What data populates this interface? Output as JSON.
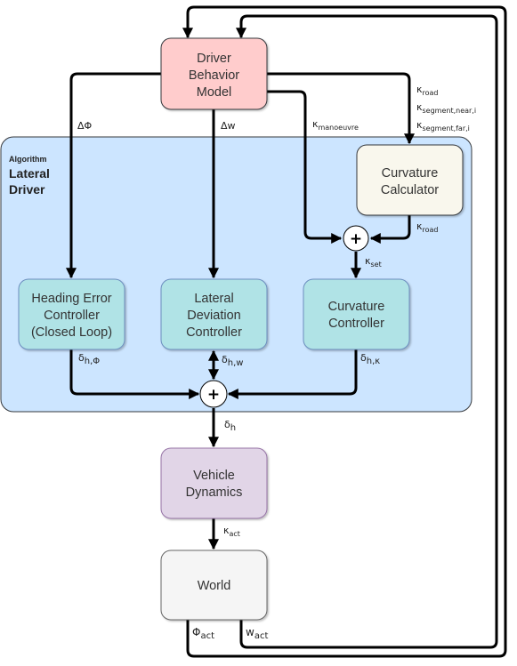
{
  "group": {
    "caption": "Algorithm",
    "title_lines": [
      "Lateral",
      "Driver"
    ],
    "fill": "#cce5ff"
  },
  "blocks": {
    "driver_behavior_model": {
      "lines": [
        "Driver",
        "Behavior",
        "Model"
      ],
      "fill": "#ffcccc"
    },
    "curvature_calculator": {
      "lines": [
        "Curvature",
        "Calculator"
      ],
      "fill": "#f9f7ed"
    },
    "heading_error_controller": {
      "lines": [
        "Heading Error",
        "Controller",
        "(Closed Loop)"
      ],
      "fill": "#b0e3e6"
    },
    "lateral_deviation_controller": {
      "lines": [
        "Lateral",
        "Deviation",
        "Controller"
      ],
      "fill": "#b0e3e6"
    },
    "curvature_controller": {
      "lines": [
        "Curvature",
        "Controller"
      ],
      "fill": "#b0e3e6"
    },
    "vehicle_dynamics": {
      "lines": [
        "Vehicle",
        "Dynamics"
      ],
      "fill": "#e1d5e7"
    },
    "world": {
      "lines": [
        "World"
      ],
      "fill": "#f5f5f5"
    }
  },
  "summing_junctions": {
    "symbol": "+"
  },
  "signals": {
    "delta_phi": {
      "base": "ΔΦ",
      "sub": ""
    },
    "delta_w": {
      "base": "Δw",
      "sub": ""
    },
    "kappa_manoeuvre": {
      "base": "κ",
      "sub": "manoeuvre"
    },
    "kappa_road_in": {
      "base": "κ",
      "sub": "road"
    },
    "kappa_segment_near": {
      "base": "κ",
      "sub": "segment,near,i"
    },
    "kappa_segment_far": {
      "base": "κ",
      "sub": "segment,far,i"
    },
    "kappa_road_out": {
      "base": "κ",
      "sub": "road"
    },
    "kappa_set": {
      "base": "κ",
      "sub": "set"
    },
    "delta_h_phi": {
      "base": "δ",
      "sub": "h,Φ"
    },
    "delta_h_w": {
      "base": "δ",
      "sub": "h,w"
    },
    "delta_h_kappa": {
      "base": "δ",
      "sub": "h,κ"
    },
    "delta_h": {
      "base": "δ",
      "sub": "h"
    },
    "kappa_act": {
      "base": "κ",
      "sub": "act"
    },
    "phi_act": {
      "base": "Φ",
      "sub": "act"
    },
    "w_act": {
      "base": "w",
      "sub": "act"
    }
  }
}
